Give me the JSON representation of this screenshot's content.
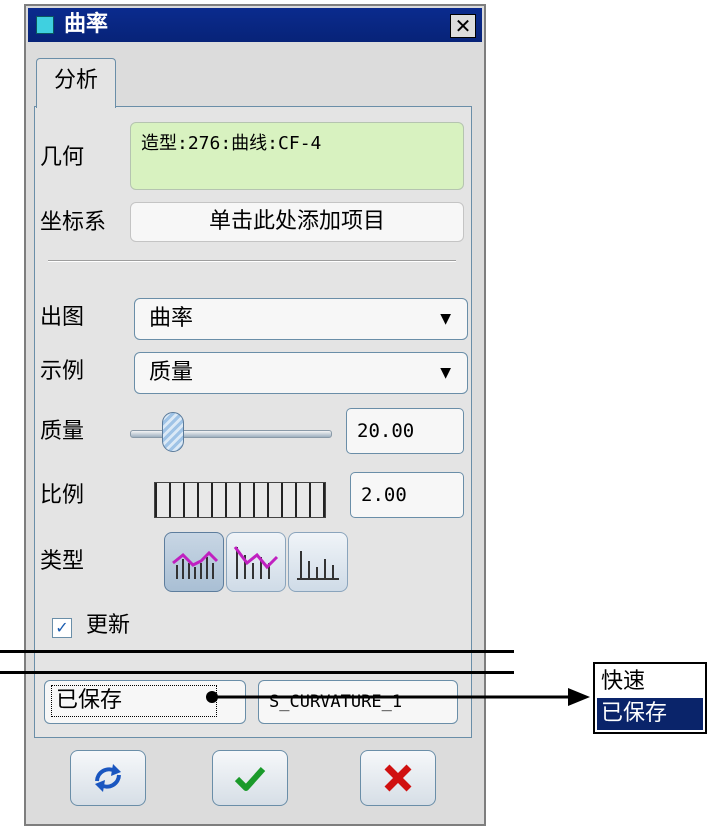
{
  "dialog": {
    "title": "曲率",
    "close_symbol": "✕",
    "tab_label": "分析"
  },
  "geometry": {
    "label": "几何",
    "value": "造型:276:曲线:CF-4"
  },
  "csys": {
    "label": "坐标系",
    "placeholder": "单击此处添加项目"
  },
  "plot": {
    "label": "出图",
    "selected": "曲率"
  },
  "sample": {
    "label": "示例",
    "selected": "质量"
  },
  "quality": {
    "label": "质量",
    "value": "20.00"
  },
  "scale": {
    "label": "比例",
    "value": "2.00"
  },
  "type": {
    "label": "类型",
    "icons": [
      "curvature-comb-icon",
      "curvature-line-icon",
      "curvature-bars-icon"
    ]
  },
  "update": {
    "label": "更新",
    "checked": true
  },
  "saved": {
    "selected": "已保存",
    "name_value": "S_CURVATURE_1"
  },
  "buttons": {
    "icons": [
      "repeat-icon",
      "check-icon",
      "cancel-icon"
    ]
  },
  "dropdown_popup": {
    "options": [
      "快速",
      "已保存"
    ],
    "selected_index": 1
  },
  "colors": {
    "title_bar": "#0b2b8e",
    "geometry_highlight": "#d8f2c0",
    "ok_green": "#1a9a2a",
    "cancel_red": "#d01010",
    "selection_blue": "#0a246a"
  }
}
